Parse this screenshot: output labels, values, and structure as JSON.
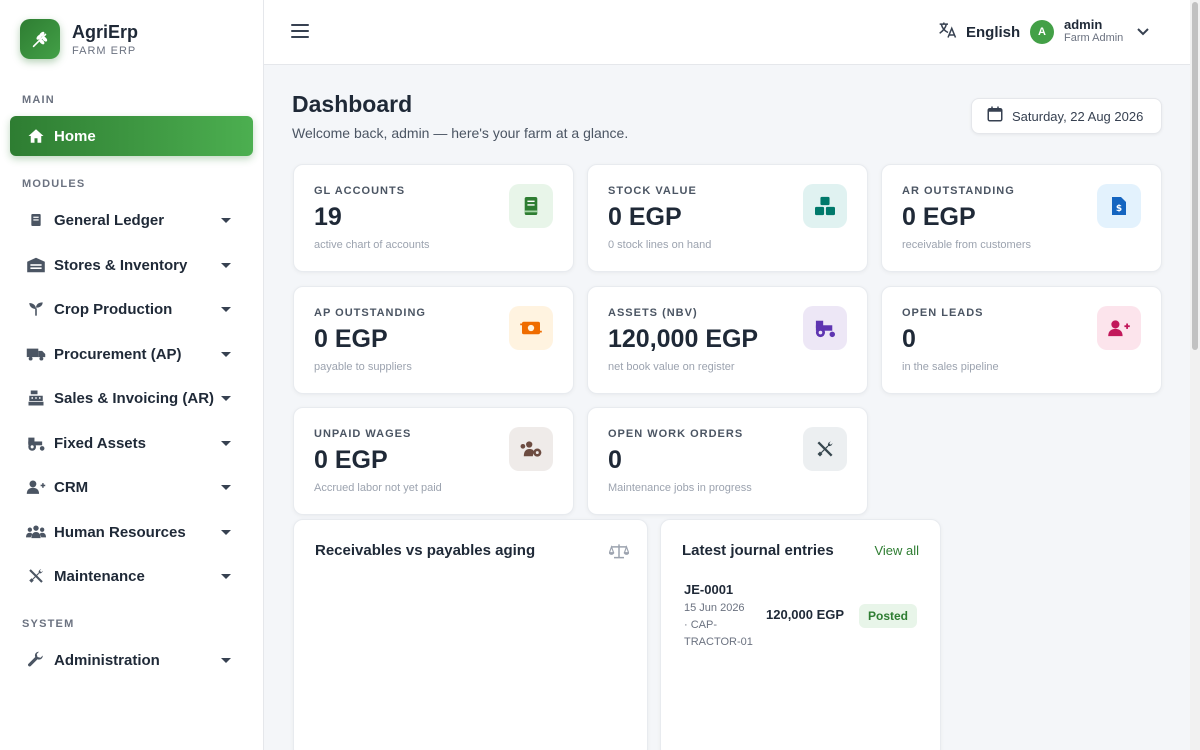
{
  "brand": {
    "name": "AgriErp",
    "subtitle": "FARM ERP"
  },
  "sidebar": {
    "section_main": "MAIN",
    "section_modules": "MODULES",
    "section_system": "SYSTEM",
    "home": "Home",
    "modules": [
      {
        "label": "General Ledger",
        "icon": "ledger-icon"
      },
      {
        "label": "Stores & Inventory",
        "icon": "warehouse-icon"
      },
      {
        "label": "Crop Production",
        "icon": "sprout-icon"
      },
      {
        "label": "Procurement (AP)",
        "icon": "truck-icon"
      },
      {
        "label": "Sales & Invoicing (AR)",
        "icon": "cash-register-icon"
      },
      {
        "label": "Fixed Assets",
        "icon": "tractor-icon"
      },
      {
        "label": "CRM",
        "icon": "add-user-icon"
      },
      {
        "label": "Human Resources",
        "icon": "people-icon"
      },
      {
        "label": "Maintenance",
        "icon": "tools-icon"
      }
    ],
    "administration": "Administration"
  },
  "topbar": {
    "language": "English",
    "user_initial": "A",
    "user_name": "admin",
    "user_role": "Farm Admin"
  },
  "page": {
    "title": "Dashboard",
    "subtitle": "Welcome back, admin — here's your farm at a glance.",
    "date": "Saturday, 22 Aug 2026"
  },
  "kpis": [
    {
      "label": "GL ACCOUNTS",
      "value": "19",
      "sub": "active chart of accounts",
      "icon": "book-icon",
      "color": "#2e7d32",
      "bg": "#e8f5e9"
    },
    {
      "label": "STOCK VALUE",
      "value": "0 EGP",
      "sub": "0 stock lines on hand",
      "icon": "boxes-icon",
      "color": "#00796b",
      "bg": "#e0f2f1"
    },
    {
      "label": "AR OUTSTANDING",
      "value": "0 EGP",
      "sub": "receivable from customers",
      "icon": "invoice-icon",
      "color": "#1565c0",
      "bg": "#e3f2fd"
    },
    {
      "label": "AP OUTSTANDING",
      "value": "0 EGP",
      "sub": "payable to suppliers",
      "icon": "money-transfer-icon",
      "color": "#ef6c00",
      "bg": "#fff3e0"
    },
    {
      "label": "ASSETS (NBV)",
      "value": "120,000 EGP",
      "sub": "net book value on register",
      "icon": "tractor-icon",
      "color": "#5e35b1",
      "bg": "#ede7f6"
    },
    {
      "label": "OPEN LEADS",
      "value": "0",
      "sub": "in the sales pipeline",
      "icon": "add-user-icon",
      "color": "#c2185b",
      "bg": "#fce4ec"
    },
    {
      "label": "UNPAID WAGES",
      "value": "0 EGP",
      "sub": "Accrued labor not yet paid",
      "icon": "people-cog-icon",
      "color": "#6d4c41",
      "bg": "#efebe9"
    },
    {
      "label": "OPEN WORK ORDERS",
      "value": "0",
      "sub": "Maintenance jobs in progress",
      "icon": "tools-icon",
      "color": "#37474f",
      "bg": "#eceff1"
    }
  ],
  "aging_panel": {
    "title": "Receivables vs payables aging",
    "icon": "balance-scale-icon"
  },
  "journal_panel": {
    "title": "Latest journal entries",
    "view_all": "View all",
    "entries": [
      {
        "id": "JE-0001",
        "date": "15 Jun 2026",
        "ref": "· CAP-TRACTOR-01",
        "amount": "120,000 EGP",
        "status": "Posted"
      }
    ]
  }
}
